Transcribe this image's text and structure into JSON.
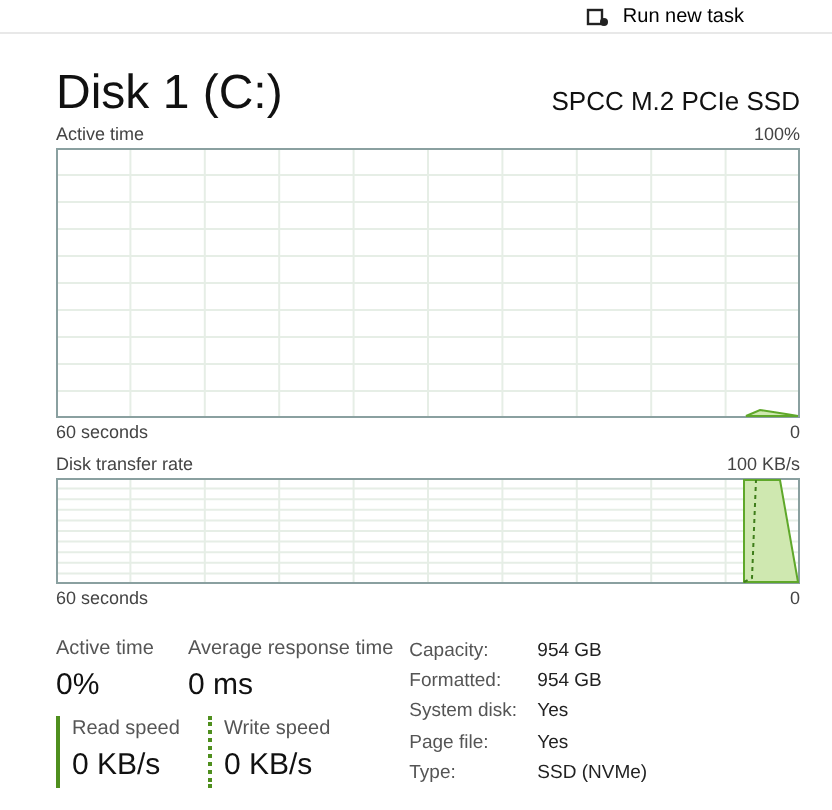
{
  "toolbar": {
    "run_task": "Run new task"
  },
  "disk": {
    "title": "Disk 1 (C:)",
    "model": "SPCC M.2 PCIe SSD"
  },
  "graphs": [
    {
      "label": "Active time",
      "max": "100%",
      "span": "60 seconds",
      "min": "0",
      "kind": "active"
    },
    {
      "label": "Disk transfer rate",
      "max": "100 KB/s",
      "span": "60 seconds",
      "min": "0",
      "kind": "transfer"
    }
  ],
  "stats": [
    {
      "label": "Active time",
      "value": "0%"
    },
    {
      "label": "Average response time",
      "value": "0 ms"
    }
  ],
  "speeds": [
    {
      "label": "Read speed",
      "value": "0 KB/s",
      "kind": "read"
    },
    {
      "label": "Write speed",
      "value": "0 KB/s",
      "kind": "write"
    }
  ],
  "details": [
    {
      "label": "Capacity:",
      "value": "954 GB"
    },
    {
      "label": "Formatted:",
      "value": "954 GB"
    },
    {
      "label": "System disk:",
      "value": "Yes"
    },
    {
      "label": "Page file:",
      "value": "Yes"
    },
    {
      "label": "Type:",
      "value": "SSD (NVMe)"
    }
  ]
}
